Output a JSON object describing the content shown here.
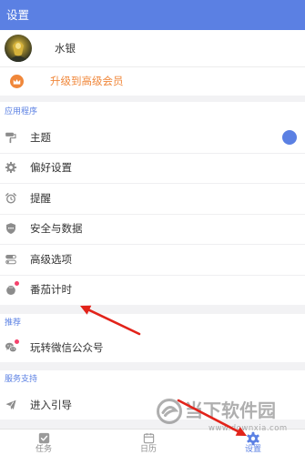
{
  "header": {
    "title": "设置"
  },
  "colors": {
    "primary": "#5b80e3",
    "upgrade": "#f0873a",
    "text": "#333333",
    "icon": "#8c8c8c",
    "badge": "#f5426c",
    "annotation": "#e2231a",
    "background": "#f2f2f4",
    "watermark": "rgba(110,110,110,0.55)"
  },
  "profile": {
    "name": "水银",
    "avatar": "user-avatar-image"
  },
  "upgrade": {
    "label": "升级到高级会员",
    "icon": "crown-icon"
  },
  "sections": [
    {
      "title": "应用程序",
      "items": [
        {
          "label": "主题",
          "icon": "paint-roller-icon",
          "swatch_color": "#5b80e3"
        },
        {
          "label": "偏好设置",
          "icon": "gear-icon"
        },
        {
          "label": "提醒",
          "icon": "alarm-clock-icon"
        },
        {
          "label": "安全与数据",
          "icon": "shield-icon"
        },
        {
          "label": "高级选项",
          "icon": "toggle-icon"
        },
        {
          "label": "番茄计时",
          "icon": "tomato-icon",
          "has_badge": true
        }
      ]
    },
    {
      "title": "推荐",
      "items": [
        {
          "label": "玩转微信公众号",
          "icon": "wechat-icon",
          "has_badge": true
        }
      ]
    },
    {
      "title": "服务支持",
      "items": [
        {
          "label": "进入引导",
          "icon": "guide-icon"
        }
      ]
    }
  ],
  "tabbar": {
    "tabs": [
      {
        "label": "任务",
        "icon": "task-checkbox-icon",
        "active": false
      },
      {
        "label": "日历",
        "icon": "calendar-icon",
        "active": false
      },
      {
        "label": "设置",
        "icon": "settings-icon",
        "active": true
      }
    ]
  },
  "watermark": {
    "brand": "当下软件园",
    "url": "www.downxia.com",
    "icon": "watermark-logo-icon"
  }
}
